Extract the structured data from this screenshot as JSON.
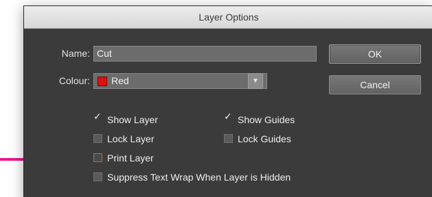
{
  "dialog": {
    "title": "Layer Options",
    "name_label": "Name:",
    "name_value": "Cut",
    "colour_label": "Colour:",
    "colour_value": "Red",
    "colour_swatch": "#e01010",
    "ok_label": "OK",
    "cancel_label": "Cancel"
  },
  "options": {
    "show_layer": {
      "label": "Show Layer",
      "checked": true
    },
    "show_guides": {
      "label": "Show Guides",
      "checked": true
    },
    "lock_layer": {
      "label": "Lock Layer",
      "checked": false
    },
    "lock_guides": {
      "label": "Lock Guides",
      "checked": false
    },
    "print_layer": {
      "label": "Print Layer",
      "checked": false
    },
    "suppress_wrap": {
      "label": "Suppress Text Wrap When Layer is Hidden",
      "checked": false
    }
  },
  "annotation": {
    "arrow_color": "#e8188c"
  }
}
